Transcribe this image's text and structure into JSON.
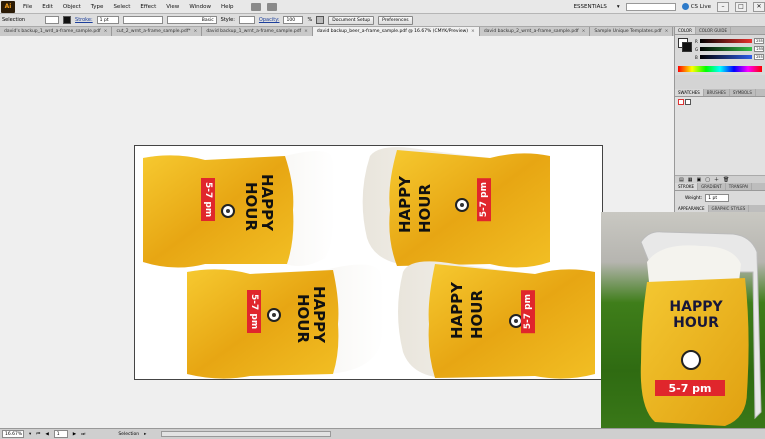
{
  "menubar": {
    "logo": "Ai",
    "items": [
      "File",
      "Edit",
      "Object",
      "Type",
      "Select",
      "Effect",
      "View",
      "Window",
      "Help"
    ],
    "workspace": "ESSENTIALS",
    "cs_live": "CS Live",
    "window_buttons": [
      "–",
      "□",
      "✕"
    ]
  },
  "controlbar": {
    "selection_label": "Selection",
    "stroke_label": "Stroke:",
    "stroke_value": "1 pt",
    "brush_label": "Basic",
    "style_label": "Style:",
    "opacity_label": "Opacity:",
    "opacity_value": "100",
    "opacity_unit": "%",
    "doc_setup": "Document Setup",
    "preferences": "Preferences"
  },
  "tabs": [
    {
      "label": "david's backup_1_wrd_a-frame_sample.pdf",
      "active": false
    },
    {
      "label": "cut_2_wrnt_a-frame_sample.pdf*",
      "active": false
    },
    {
      "label": "david backup_1_wrnt_a-frame_sample.pdf",
      "active": false
    },
    {
      "label": "david backup_beer_a-frame_sample.pdf @ 16.67% (CMYK/Preview)",
      "active": true
    },
    {
      "label": "david backup_2_wrnt_a-frame_sample.pdf",
      "active": false
    },
    {
      "label": "Sample Unique Templates.pdf",
      "active": false
    },
    {
      "label": "david backup_2",
      "active": false
    }
  ],
  "artwork": {
    "happy": "HAPPY",
    "hour": "HOUR",
    "time": "5-7 pm"
  },
  "panels": {
    "color_tabs": [
      "COLOR",
      "COLOR GUIDE"
    ],
    "channels": [
      {
        "name": "R",
        "value": "255",
        "color": "#e8322e"
      },
      {
        "name": "G",
        "value": "255",
        "color": "#33c24a"
      },
      {
        "name": "B",
        "value": "255",
        "color": "#2e5ee8"
      }
    ],
    "swatch_tabs": [
      "SWATCHES",
      "BRUSHES",
      "SYMBOLS"
    ],
    "stroke_tabs": [
      "STROKE",
      "GRADIENT",
      "TRANSPAI"
    ],
    "weight_label": "Weight:",
    "weight_value": "1 pt",
    "appearance_tabs": [
      "APPEARANCE",
      "GRAPHIC STYLES"
    ]
  },
  "statusbar": {
    "zoom": "16.67%",
    "page": "1",
    "tool": "Selection"
  },
  "photo": {
    "happy": "HAPPY",
    "hour": "HOUR",
    "time": "5-7 pm"
  }
}
